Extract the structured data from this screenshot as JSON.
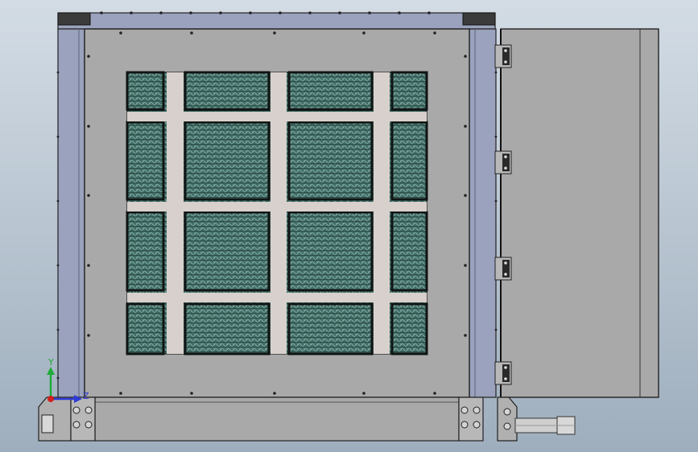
{
  "scene": {
    "background_top": "#d3dce5",
    "background_bottom": "#9eaebd",
    "panel_gray": "#a9a9a9",
    "frame_blue": "#9ba2bd",
    "coil_bar": "#d8d0cc",
    "coil_green": "#3f6d66",
    "coil_dark": "#1f2a28",
    "hinge_gray": "#b8b8b8",
    "pipe_gray": "#cfcfcf"
  },
  "triad": {
    "x_axis": "Z",
    "y_axis": "Y",
    "x_color": "#2e3bd6",
    "y_color": "#1faa3a",
    "z_color": "#d21f1f"
  }
}
